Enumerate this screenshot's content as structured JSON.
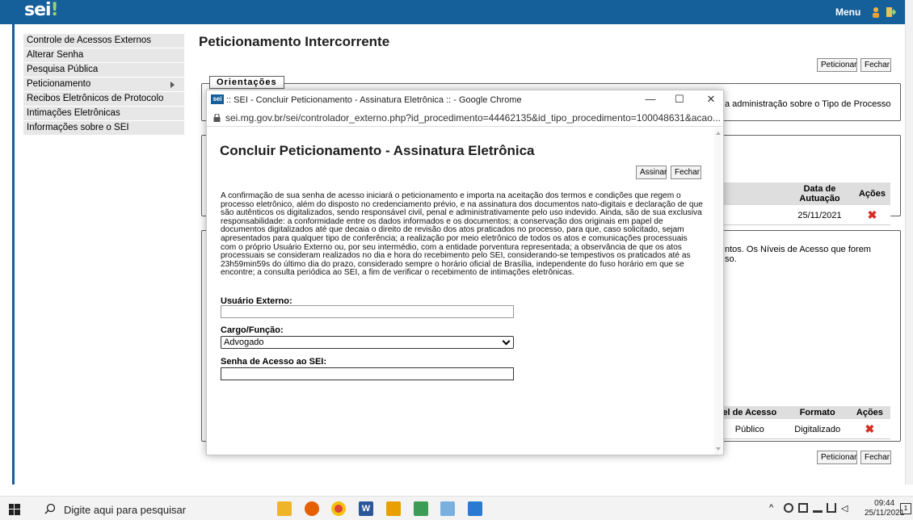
{
  "header": {
    "logo": "sei",
    "logo_bang": "!",
    "menu_label": "Menu"
  },
  "sidebar": {
    "items": [
      {
        "label": "Controle de Acessos Externos"
      },
      {
        "label": "Alterar Senha"
      },
      {
        "label": "Pesquisa Pública"
      },
      {
        "label": "Peticionamento"
      },
      {
        "label": "Recibos Eletrônicos de Protocolo"
      },
      {
        "label": "Intimações Eletrônicas"
      },
      {
        "label": "Informações sobre o SEI"
      }
    ]
  },
  "main": {
    "title": "Peticionamento Intercorrente",
    "peticionar_label": "Peticionar",
    "fechar_label": "Fechar",
    "orientacoes_legend": "Orientações",
    "orientacoes_text": "a administração sobre o Tipo de Processo",
    "processos_table": {
      "headers": [
        "Data de Autuação",
        "Ações"
      ],
      "rows": [
        [
          "25/11/2021",
          "✖"
        ]
      ]
    },
    "documentos_text_1": "ntos. Os Níveis de Acesso que forem",
    "documentos_text_2": "so.",
    "documentos_table": {
      "headers": [
        "el de Acesso",
        "Formato",
        "Ações"
      ],
      "rows": [
        [
          "Público",
          "Digitalizado",
          "✖"
        ]
      ]
    }
  },
  "popup": {
    "window_title": ":: SEI - Concluir Peticionamento - Assinatura Eletrônica :: - Google Chrome",
    "url": "sei.mg.gov.br/sei/controlador_externo.php?id_procedimento=44462135&id_tipo_procedimento=100048631&acao...",
    "favicon_label": "sei",
    "dialog_title": "Concluir Peticionamento - Assinatura Eletrônica",
    "assinar_label": "Assinar",
    "fechar_label": "Fechar",
    "text": "A confirmação de sua senha de acesso iniciará o peticionamento e importa na aceitação dos termos e condições que regem o processo eletrônico, além do disposto no credenciamento prévio, e na assinatura dos documentos nato-digitais e declaração de que são autênticos os digitalizados, sendo responsável civil, penal e administrativamente pelo uso indevido. Ainda, são de sua exclusiva responsabilidade: a conformidade entre os dados informados e os documentos; a conservação dos originais em papel de documentos digitalizados até que decaia o direito de revisão dos atos praticados no processo, para que, caso solicitado, sejam apresentados para qualquer tipo de conferência; a realização por meio eletrônico de todos os atos e comunicações processuais com o próprio Usuário Externo ou, por seu intermédio, com a entidade porventura representada; a observância de que os atos processuais se consideram realizados no dia e hora do recebimento pelo SEI, considerando-se tempestivos os praticados até as 23h59min59s do último dia do prazo, considerado sempre o horário oficial de Brasília, independente do fuso horário em que se encontre; a consulta periódica ao SEI, a fim de verificar o recebimento de intimações eletrônicas.",
    "usuario_label": "Usuário Externo:",
    "usuario_value": "",
    "cargo_label": "Cargo/Função:",
    "cargo_value": "Advogado",
    "senha_label": "Senha de Acesso ao SEI:",
    "senha_value": ""
  },
  "taskbar": {
    "search_placeholder": "Digite aqui para pesquisar",
    "time": "09:44",
    "date": "25/11/2021",
    "notification_count": "1"
  },
  "colors": {
    "sei_blue": "#155f9b",
    "delete_red": "#d62d20"
  }
}
